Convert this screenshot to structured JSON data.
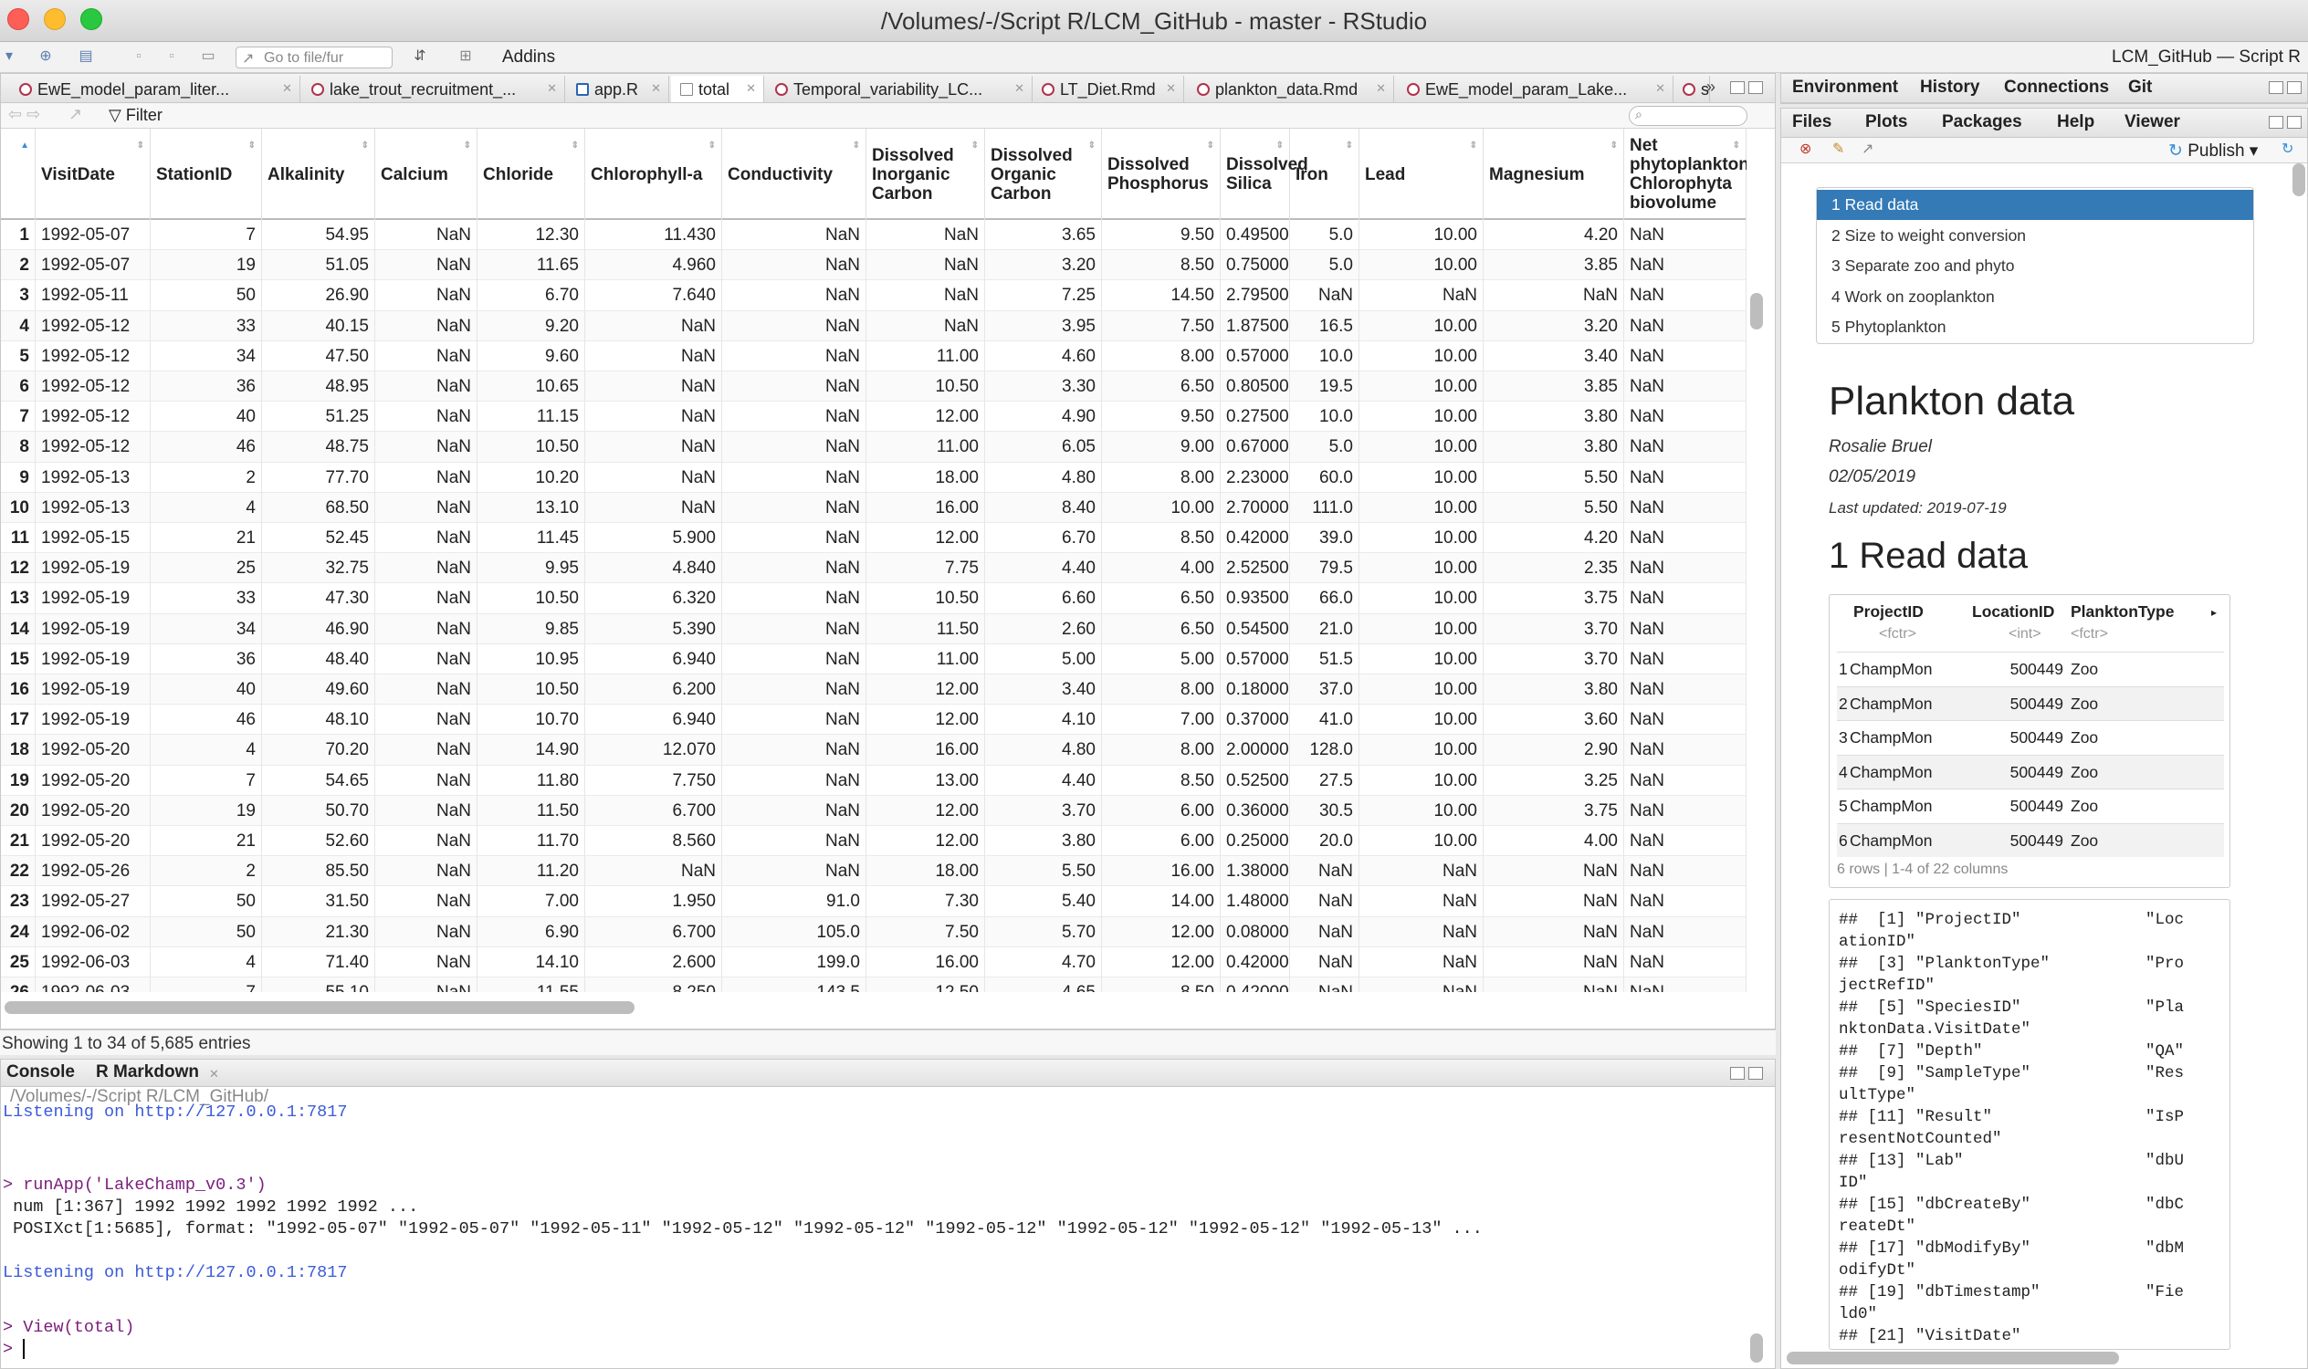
{
  "window": {
    "title": "/Volumes/-/Script R/LCM_GitHub - master - RStudio"
  },
  "toolbar": {
    "goto_placeholder": "Go to file/fur",
    "addins": "Addins",
    "project": "LCM_GitHub — Script R"
  },
  "source_tabs": [
    "EwE_model_param_liter...",
    "lake_trout_recruitment_...",
    "app.R",
    "total",
    "Temporal_variability_LC...",
    "LT_Diet.Rmd",
    "plankton_data.Rmd",
    "EwE_model_param_Lake...",
    "s"
  ],
  "filter": {
    "label": "Filter"
  },
  "grid": {
    "columns": [
      "VisitDate",
      "StationID",
      "Alkalinity",
      "Calcium",
      "Chloride",
      "Chlorophyll-a",
      "Conductivity",
      "Dissolved Inorganic Carbon",
      "Dissolved Organic Carbon",
      "Dissolved Phosphorus",
      "Dissolved Silica",
      "Iron",
      "Lead",
      "Magnesium",
      "Net phytoplankton, Chlorophyta biovolume"
    ],
    "rows": [
      [
        "1",
        "1992-05-07",
        "7",
        "54.95",
        "NaN",
        "12.30",
        "11.430",
        "NaN",
        "NaN",
        "3.65",
        "9.50",
        "0.495000",
        "5.0",
        "10.00",
        "4.20",
        "NaN"
      ],
      [
        "2",
        "1992-05-07",
        "19",
        "51.05",
        "NaN",
        "11.65",
        "4.960",
        "NaN",
        "NaN",
        "3.20",
        "8.50",
        "0.750000",
        "5.0",
        "10.00",
        "3.85",
        "NaN"
      ],
      [
        "3",
        "1992-05-11",
        "50",
        "26.90",
        "NaN",
        "6.70",
        "7.640",
        "NaN",
        "NaN",
        "7.25",
        "14.50",
        "2.795000",
        "NaN",
        "NaN",
        "NaN",
        "NaN"
      ],
      [
        "4",
        "1992-05-12",
        "33",
        "40.15",
        "NaN",
        "9.20",
        "NaN",
        "NaN",
        "NaN",
        "3.95",
        "7.50",
        "1.875000",
        "16.5",
        "10.00",
        "3.20",
        "NaN"
      ],
      [
        "5",
        "1992-05-12",
        "34",
        "47.50",
        "NaN",
        "9.60",
        "NaN",
        "NaN",
        "11.00",
        "4.60",
        "8.00",
        "0.570000",
        "10.0",
        "10.00",
        "3.40",
        "NaN"
      ],
      [
        "6",
        "1992-05-12",
        "36",
        "48.95",
        "NaN",
        "10.65",
        "NaN",
        "NaN",
        "10.50",
        "3.30",
        "6.50",
        "0.805000",
        "19.5",
        "10.00",
        "3.85",
        "NaN"
      ],
      [
        "7",
        "1992-05-12",
        "40",
        "51.25",
        "NaN",
        "11.15",
        "NaN",
        "NaN",
        "12.00",
        "4.90",
        "9.50",
        "0.275000",
        "10.0",
        "10.00",
        "3.80",
        "NaN"
      ],
      [
        "8",
        "1992-05-12",
        "46",
        "48.75",
        "NaN",
        "10.50",
        "NaN",
        "NaN",
        "11.00",
        "6.05",
        "9.00",
        "0.670000",
        "5.0",
        "10.00",
        "3.80",
        "NaN"
      ],
      [
        "9",
        "1992-05-13",
        "2",
        "77.70",
        "NaN",
        "10.20",
        "NaN",
        "NaN",
        "18.00",
        "4.80",
        "8.00",
        "2.230000",
        "60.0",
        "10.00",
        "5.50",
        "NaN"
      ],
      [
        "10",
        "1992-05-13",
        "4",
        "68.50",
        "NaN",
        "13.10",
        "NaN",
        "NaN",
        "16.00",
        "8.40",
        "10.00",
        "2.700000",
        "111.0",
        "10.00",
        "5.50",
        "NaN"
      ],
      [
        "11",
        "1992-05-15",
        "21",
        "52.45",
        "NaN",
        "11.45",
        "5.900",
        "NaN",
        "12.00",
        "6.70",
        "8.50",
        "0.420000",
        "39.0",
        "10.00",
        "4.20",
        "NaN"
      ],
      [
        "12",
        "1992-05-19",
        "25",
        "32.75",
        "NaN",
        "9.95",
        "4.840",
        "NaN",
        "7.75",
        "4.40",
        "4.00",
        "2.525000",
        "79.5",
        "10.00",
        "2.35",
        "NaN"
      ],
      [
        "13",
        "1992-05-19",
        "33",
        "47.30",
        "NaN",
        "10.50",
        "6.320",
        "NaN",
        "10.50",
        "6.60",
        "6.50",
        "0.935000",
        "66.0",
        "10.00",
        "3.75",
        "NaN"
      ],
      [
        "14",
        "1992-05-19",
        "34",
        "46.90",
        "NaN",
        "9.85",
        "5.390",
        "NaN",
        "11.50",
        "2.60",
        "6.50",
        "0.545000",
        "21.0",
        "10.00",
        "3.70",
        "NaN"
      ],
      [
        "15",
        "1992-05-19",
        "36",
        "48.40",
        "NaN",
        "10.95",
        "6.940",
        "NaN",
        "11.00",
        "5.00",
        "5.00",
        "0.570000",
        "51.5",
        "10.00",
        "3.70",
        "NaN"
      ],
      [
        "16",
        "1992-05-19",
        "40",
        "49.60",
        "NaN",
        "10.50",
        "6.200",
        "NaN",
        "12.00",
        "3.40",
        "8.00",
        "0.180000",
        "37.0",
        "10.00",
        "3.80",
        "NaN"
      ],
      [
        "17",
        "1992-05-19",
        "46",
        "48.10",
        "NaN",
        "10.70",
        "6.940",
        "NaN",
        "12.00",
        "4.10",
        "7.00",
        "0.370000",
        "41.0",
        "10.00",
        "3.60",
        "NaN"
      ],
      [
        "18",
        "1992-05-20",
        "4",
        "70.20",
        "NaN",
        "14.90",
        "12.070",
        "NaN",
        "16.00",
        "4.80",
        "8.00",
        "2.000000",
        "128.0",
        "10.00",
        "2.90",
        "NaN"
      ],
      [
        "19",
        "1992-05-20",
        "7",
        "54.65",
        "NaN",
        "11.80",
        "7.750",
        "NaN",
        "13.00",
        "4.40",
        "8.50",
        "0.525000",
        "27.5",
        "10.00",
        "3.25",
        "NaN"
      ],
      [
        "20",
        "1992-05-20",
        "19",
        "50.70",
        "NaN",
        "11.50",
        "6.700",
        "NaN",
        "12.00",
        "3.70",
        "6.00",
        "0.360000",
        "30.5",
        "10.00",
        "3.75",
        "NaN"
      ],
      [
        "21",
        "1992-05-20",
        "21",
        "52.60",
        "NaN",
        "11.70",
        "8.560",
        "NaN",
        "12.00",
        "3.80",
        "6.00",
        "0.250000",
        "20.0",
        "10.00",
        "4.00",
        "NaN"
      ],
      [
        "22",
        "1992-05-26",
        "2",
        "85.50",
        "NaN",
        "11.20",
        "NaN",
        "NaN",
        "18.00",
        "5.50",
        "16.00",
        "1.380000",
        "NaN",
        "NaN",
        "NaN",
        "NaN"
      ],
      [
        "23",
        "1992-05-27",
        "50",
        "31.50",
        "NaN",
        "7.00",
        "1.950",
        "91.0",
        "7.30",
        "5.40",
        "14.00",
        "1.480000",
        "NaN",
        "NaN",
        "NaN",
        "NaN"
      ],
      [
        "24",
        "1992-06-02",
        "50",
        "21.30",
        "NaN",
        "6.90",
        "6.700",
        "105.0",
        "7.50",
        "5.70",
        "12.00",
        "0.080000",
        "NaN",
        "NaN",
        "NaN",
        "NaN"
      ],
      [
        "25",
        "1992-06-03",
        "4",
        "71.40",
        "NaN",
        "14.10",
        "2.600",
        "199.0",
        "16.00",
        "4.70",
        "12.00",
        "0.420000",
        "NaN",
        "NaN",
        "NaN",
        "NaN"
      ],
      [
        "26",
        "1992-06-03",
        "7",
        "55.10",
        "NaN",
        "11.55",
        "8.250",
        "143.5",
        "12.50",
        "4.65",
        "8.50",
        "0.420000",
        "NaN",
        "NaN",
        "NaN",
        "NaN"
      ]
    ],
    "showing": "Showing 1 to 34 of 5,685 entries"
  },
  "console": {
    "tabs": [
      "Console",
      "R Markdown"
    ],
    "path": "/Volumes/-/Script R/LCM_GitHub/",
    "lines": [
      {
        "text": "Listening on http://127.0.0.1:7817",
        "kind": "blue"
      },
      {
        "text": "> runApp('LakeChamp_v0.3')",
        "kind": "purp"
      },
      {
        "text": " num [1:367] 1992 1992 1992 1992 1992 ...",
        "kind": "plain"
      },
      {
        "text": " POSIXct[1:5685], format: \"1992-05-07\" \"1992-05-07\" \"1992-05-11\" \"1992-05-12\" \"1992-05-12\" \"1992-05-12\" \"1992-05-12\" \"1992-05-12\" \"1992-05-13\" ...",
        "kind": "plain"
      },
      {
        "text": "Listening on http://127.0.0.1:7817",
        "kind": "blue"
      },
      {
        "text": "> View(total)",
        "kind": "purp"
      },
      {
        "text": "> ",
        "kind": "purp"
      }
    ]
  },
  "env_tabs": [
    "Environment",
    "History",
    "Connections",
    "Git"
  ],
  "viewer_tabs": [
    "Files",
    "Plots",
    "Packages",
    "Help",
    "Viewer"
  ],
  "viewer": {
    "publish": "Publish",
    "toc": [
      "1 Read data",
      "2 Size to weight conversion",
      "3 Separate zoo and phyto",
      "4 Work on zooplankton",
      "5 Phytoplankton"
    ],
    "title": "Plankton data",
    "author": "Rosalie Bruel",
    "date": "02/05/2019",
    "updated": "Last updated: 2019-07-19",
    "section": "1 Read data",
    "table": {
      "headers": [
        "ProjectID",
        "LocationID",
        "PlanktonType"
      ],
      "types": [
        "<fctr>",
        "<int>",
        "<fctr>"
      ],
      "rows": [
        [
          "1",
          "ChampMon",
          "500449",
          "Zoo"
        ],
        [
          "2",
          "ChampMon",
          "500449",
          "Zoo"
        ],
        [
          "3",
          "ChampMon",
          "500449",
          "Zoo"
        ],
        [
          "4",
          "ChampMon",
          "500449",
          "Zoo"
        ],
        [
          "5",
          "ChampMon",
          "500449",
          "Zoo"
        ],
        [
          "6",
          "ChampMon",
          "500449",
          "Zoo"
        ]
      ],
      "footer": "6 rows | 1-4 of 22 columns"
    },
    "code_lines": [
      "##  [1] \"ProjectID\"             \"Loc",
      "ationID\"",
      "##  [3] \"PlanktonType\"          \"Pro",
      "jectRefID\"",
      "##  [5] \"SpeciesID\"             \"Pla",
      "nktonData.VisitDate\"",
      "##  [7] \"Depth\"                 \"QA\"",
      "##  [9] \"SampleType\"            \"Res",
      "ultType\"",
      "## [11] \"Result\"                \"IsP",
      "resentNotCounted\"",
      "## [13] \"Lab\"                   \"dbU",
      "ID\"",
      "## [15] \"dbCreateBy\"            \"dbC",
      "reateDt\"",
      "## [17] \"dbModifyBy\"            \"dbM",
      "odifyDt\"",
      "## [19] \"dbTimestamp\"           \"Fie",
      "ld0\"",
      "## [21] \"VisitDate\""
    ]
  }
}
